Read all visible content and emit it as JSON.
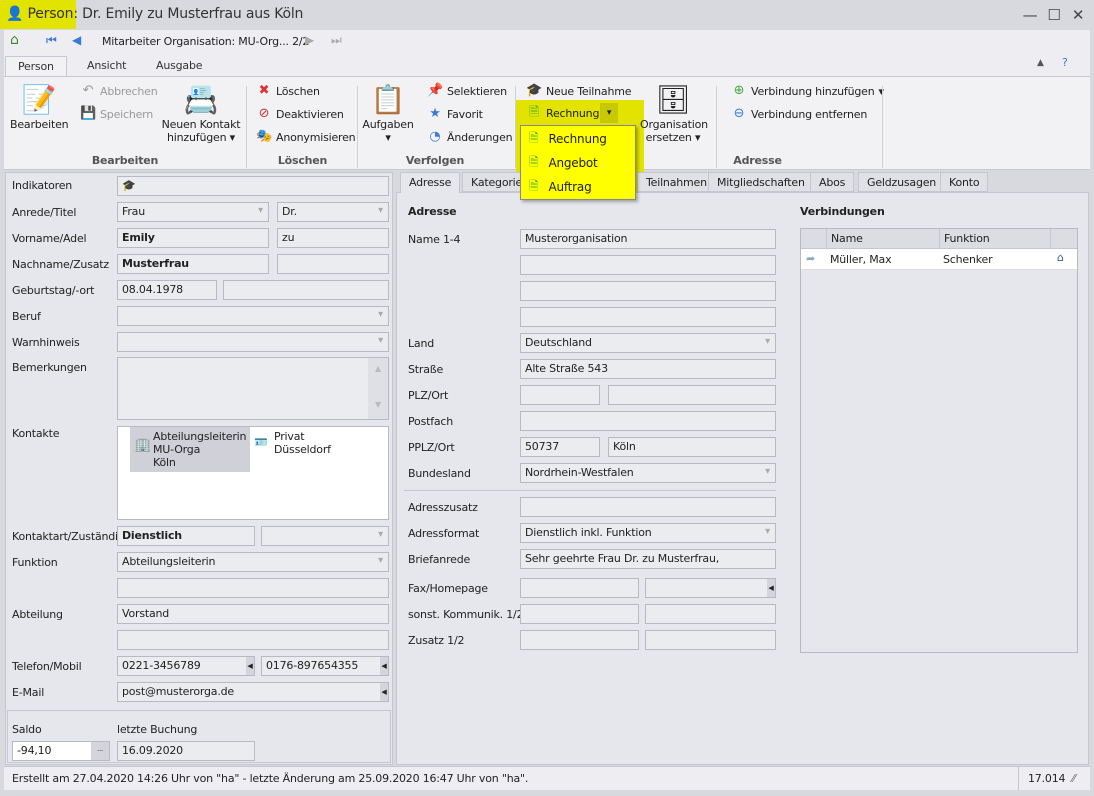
{
  "window": {
    "title": "Person: Dr. Emily zu Musterfrau aus Köln",
    "minimize": "—",
    "maximize": "☐",
    "close": "✕",
    "highlight": "#e3e300"
  },
  "nav": {
    "record_label": "Mitarbeiter Organisation: MU-Org... 2/2"
  },
  "ribbon_tabs": [
    {
      "label": "Person"
    },
    {
      "label": "Ansicht"
    },
    {
      "label": "Ausgabe"
    }
  ],
  "ribbon": {
    "bearbeiten": {
      "label": "Bearbeiten",
      "edit": "Bearbeiten",
      "cancel": "Abbrechen",
      "save": "Speichern",
      "new_contact_1": "Neuen Kontakt",
      "new_contact_2": "hinzufügen"
    },
    "loeschen": {
      "label": "Löschen",
      "delete": "Löschen",
      "deactivate": "Deaktivieren",
      "anonymize": "Anonymisieren"
    },
    "verfolgen": {
      "label": "Verfolgen",
      "tasks": "Aufgaben",
      "select": "Selektieren",
      "favorite": "Favorit",
      "changes": "Änderungen"
    },
    "adresse": {
      "label": "Adresse",
      "new_participation": "Neue Teilnahme",
      "invoice": "Rechnung",
      "org_replace_1": "Organisation",
      "org_replace_2": "ersetzen",
      "add_connection": "Verbindung hinzufügen",
      "remove_connection": "Verbindung entfernen"
    }
  },
  "dropdown_menu": {
    "highlight": "#ffff00",
    "items": [
      {
        "label": "Rechnung"
      },
      {
        "label": "Angebot"
      },
      {
        "label": "Auftrag"
      }
    ]
  },
  "left": {
    "indikatoren": "Indikatoren",
    "anrede_label": "Anrede/Titel",
    "anrede": "Frau",
    "titel": "Dr.",
    "vorname_label": "Vorname/Adel",
    "vorname": "Emily",
    "adel": "zu",
    "nachname_label": "Nachname/Zusatz",
    "nachname": "Musterfrau",
    "geburtstag_label": "Geburtstag/-ort",
    "geburtstag": "08.04.1978",
    "beruf_label": "Beruf",
    "warnhinweis_label": "Warnhinweis",
    "bemerkungen_label": "Bemerkungen",
    "kontakte_label": "Kontakte",
    "kontakte": [
      {
        "l1": "Abteilungsleiterin",
        "l2": "MU-Orga",
        "l3": "Köln"
      },
      {
        "l1": "Privat",
        "l2": "Düsseldorf"
      }
    ],
    "kontaktart_label": "Kontaktart/Zuständig",
    "kontaktart": "Dienstlich",
    "funktion_label": "Funktion",
    "funktion": "Abteilungsleiterin",
    "abteilung_label": "Abteilung",
    "abteilung": "Vorstand",
    "telefon_label": "Telefon/Mobil",
    "telefon": "0221-3456789",
    "mobil": "0176-897654355",
    "email_label": "E-Mail",
    "email": "post@musterorga.de",
    "saldo_label": "Saldo",
    "saldo": "-94,10",
    "buchung_label": "letzte Buchung",
    "buchung": "16.09.2020"
  },
  "panel_tabs": [
    {
      "label": "Adresse"
    },
    {
      "label": "Kategorien"
    },
    {
      "label": "Teilnahmen"
    },
    {
      "label": "Mitgliedschaften"
    },
    {
      "label": "Abos"
    },
    {
      "label": "Geldzusagen"
    },
    {
      "label": "Konto"
    }
  ],
  "address": {
    "heading": "Adresse",
    "name_label": "Name 1-4",
    "name1": "Musterorganisation",
    "land_label": "Land",
    "land": "Deutschland",
    "strasse_label": "Straße",
    "strasse": "Alte Straße 543",
    "plz_label": "PLZ/Ort",
    "postfach_label": "Postfach",
    "pplz_label": "PPLZ/Ort",
    "pplz": "50737",
    "port": "Köln",
    "bundesland_label": "Bundesland",
    "bundesland": "Nordrhein-Westfalen",
    "adresszusatz_label": "Adresszusatz",
    "adressformat_label": "Adressformat",
    "adressformat": "Dienstlich inkl. Funktion",
    "briefanrede_label": "Briefanrede",
    "briefanrede": "Sehr geehrte Frau Dr. zu Musterfrau,",
    "fax_label": "Fax/Homepage",
    "sonst_label": "sonst. Kommunik. 1/2",
    "zusatz_label": "Zusatz 1/2"
  },
  "connections": {
    "heading": "Verbindungen",
    "columns": [
      "Name",
      "Funktion"
    ],
    "rows": [
      {
        "name": "Müller, Max",
        "funktion": "Schenker"
      }
    ]
  },
  "status": {
    "text": "Erstellt am 27.04.2020 14:26 Uhr von \"ha\" - letzte Änderung am 25.09.2020 16:47 Uhr von \"ha\".",
    "number": "17.014"
  }
}
